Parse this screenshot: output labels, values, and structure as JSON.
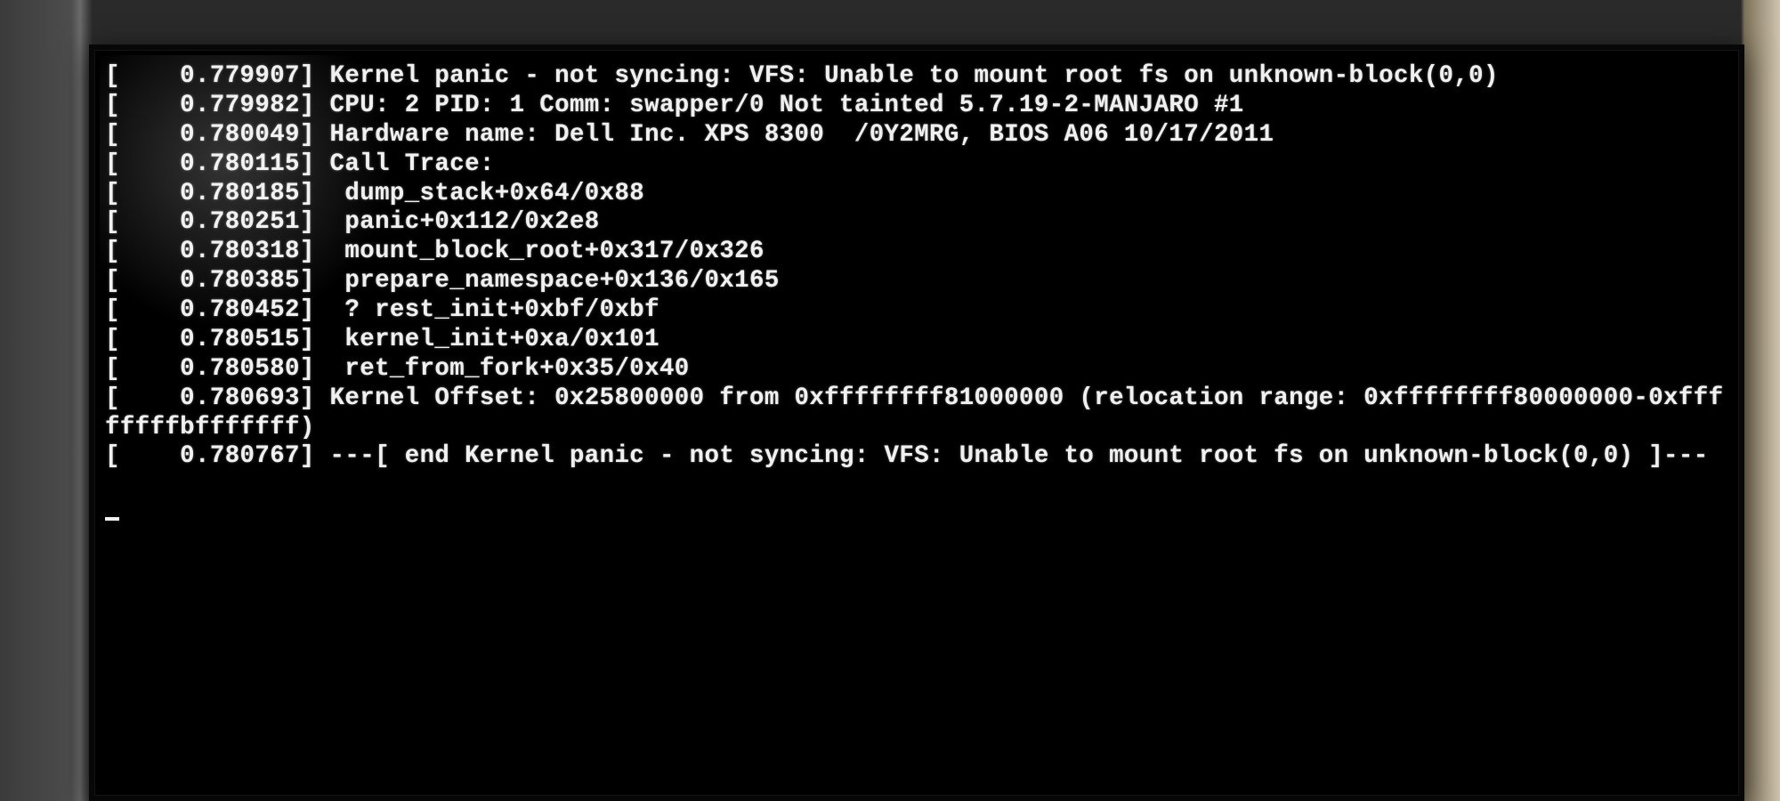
{
  "console": {
    "rows": [
      {
        "ts": "0.779907",
        "msg": "Kernel panic - not syncing: VFS: Unable to mount root fs on unknown-block(0,0)"
      },
      {
        "ts": "0.779982",
        "msg": "CPU: 2 PID: 1 Comm: swapper/0 Not tainted 5.7.19-2-MANJARO #1"
      },
      {
        "ts": "0.780049",
        "msg": "Hardware name: Dell Inc. XPS 8300  /0Y2MRG, BIOS A06 10/17/2011"
      },
      {
        "ts": "0.780115",
        "msg": "Call Trace:"
      },
      {
        "ts": "0.780185",
        "msg": " dump_stack+0x64/0x88"
      },
      {
        "ts": "0.780251",
        "msg": " panic+0x112/0x2e8"
      },
      {
        "ts": "0.780318",
        "msg": " mount_block_root+0x317/0x326"
      },
      {
        "ts": "0.780385",
        "msg": " prepare_namespace+0x136/0x165"
      },
      {
        "ts": "0.780452",
        "msg": " ? rest_init+0xbf/0xbf"
      },
      {
        "ts": "0.780515",
        "msg": " kernel_init+0xa/0x101"
      },
      {
        "ts": "0.780580",
        "msg": " ret_from_fork+0x35/0x40"
      },
      {
        "ts": "0.780693",
        "msg": "Kernel Offset: 0x25800000 from 0xffffffff81000000 (relocation range: 0xffffffff80000000-0xffffffffbfffffff)"
      },
      {
        "ts": "0.780767",
        "msg": "---[ end Kernel panic - not syncing: VFS: Unable to mount root fs on unknown-block(0,0) ]---"
      }
    ]
  }
}
